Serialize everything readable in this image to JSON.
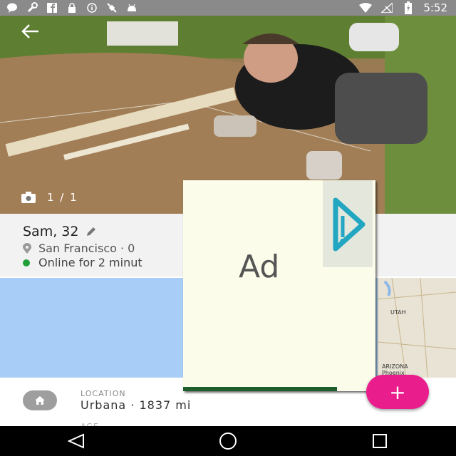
{
  "status_bar": {
    "time": "5:52",
    "left_icons": [
      "message-icon",
      "wrench-icon",
      "facebook-icon",
      "lock-icon",
      "info-icon",
      "satellite-icon",
      "android-icon"
    ],
    "right_icons": [
      "wifi-icon",
      "signal-off-icon",
      "battery-charging-icon"
    ]
  },
  "photo": {
    "counter": "1 / 1"
  },
  "profile": {
    "name": "Sam, 32",
    "location_distance": "San Francisco · 0",
    "online_status": "Online for 2 minut"
  },
  "map": {
    "labels": [
      "UTAH",
      "ARIZONA",
      "Phoenix"
    ]
  },
  "ad": {
    "label": "Ad"
  },
  "details": {
    "location_label": "LOCATION",
    "location_value": "Urbana · 1837 mi",
    "next_label": "AGE"
  },
  "fab": {
    "label": "+"
  },
  "colors": {
    "accent": "#e91e8c",
    "online": "#21a037",
    "status_bar": "#8a8a8a"
  }
}
